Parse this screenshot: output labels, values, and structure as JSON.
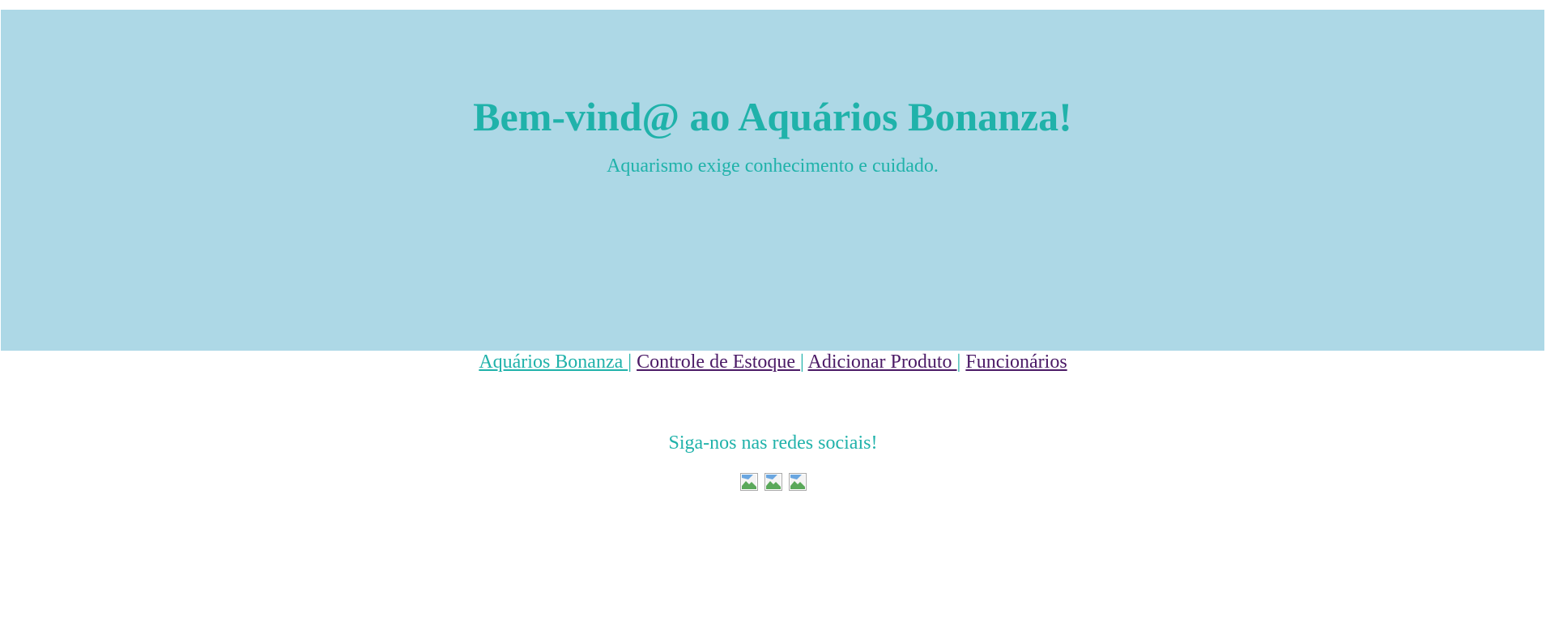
{
  "hero": {
    "title": "Bem-vind@ ao Aquários Bonanza!",
    "subtitle": "Aquarismo exige conhecimento e cuidado."
  },
  "nav": {
    "items": [
      {
        "label": "Aquários Bonanza ",
        "current": true
      },
      {
        "label": "Controle de Estoque ",
        "current": false
      },
      {
        "label": "Adicionar Produto ",
        "current": false
      },
      {
        "label": "Funcionários",
        "current": false
      }
    ],
    "separator": "|"
  },
  "social": {
    "heading": "Siga-nos nas redes sociais!",
    "icons": [
      "social-icon-1",
      "social-icon-2",
      "social-icon-3"
    ]
  },
  "colors": {
    "hero_background": "#add8e6",
    "accent_text": "#20b2aa",
    "visited_link": "#4b1a66"
  }
}
